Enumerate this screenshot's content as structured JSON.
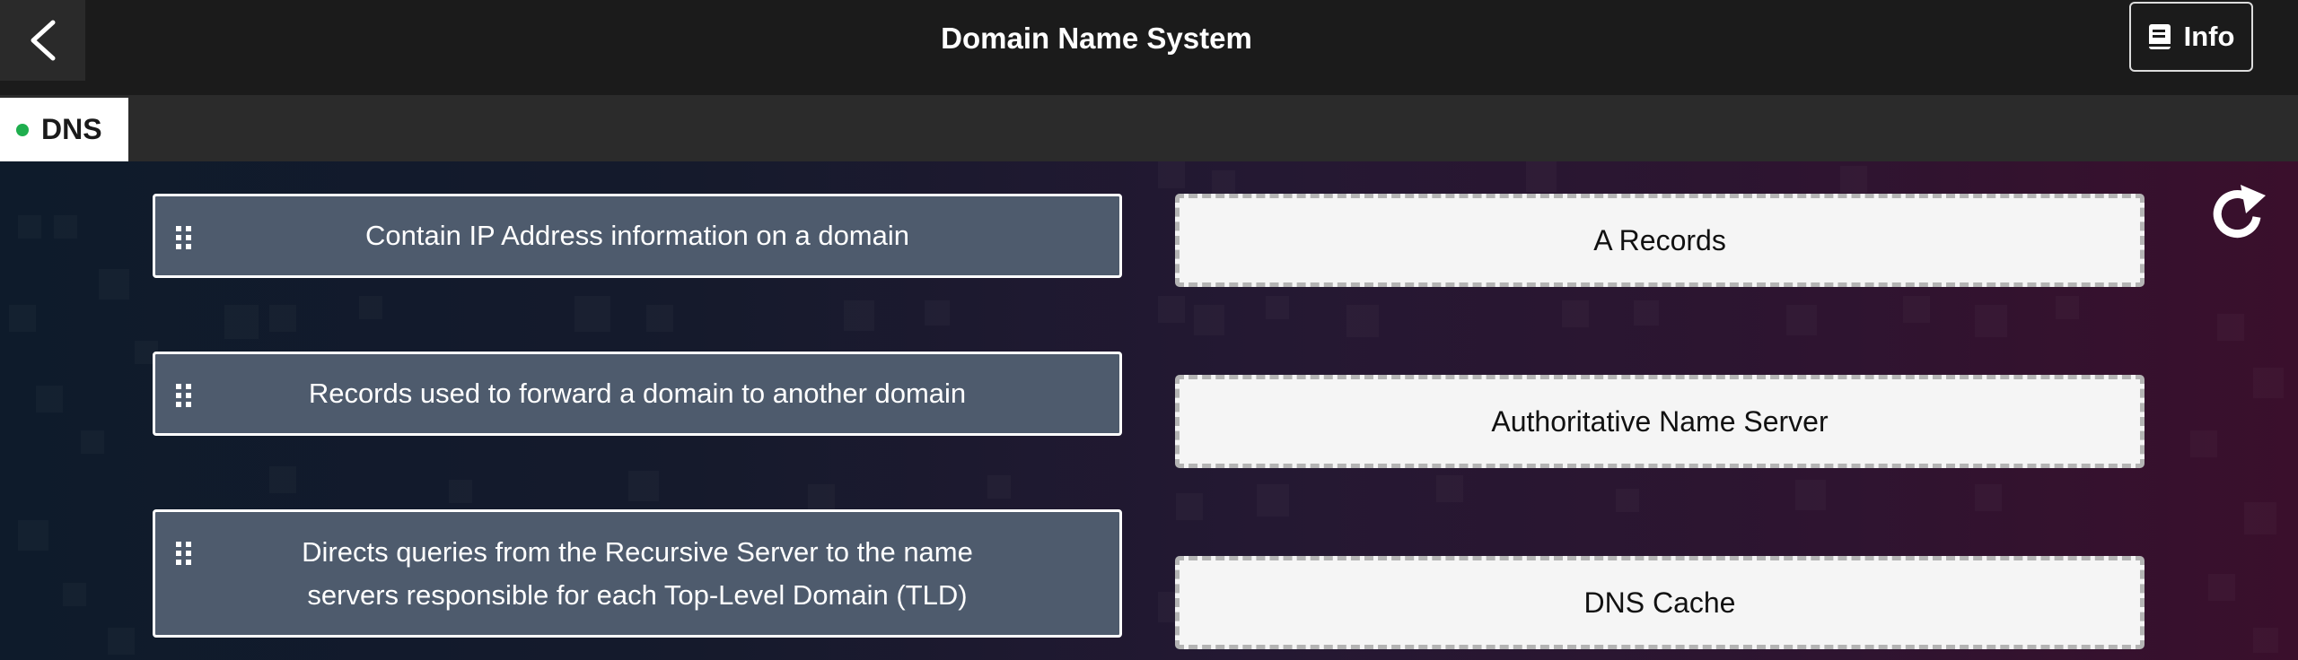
{
  "header": {
    "back_icon": "chevron-left-icon",
    "title": "Domain Name System",
    "info_label": "Info",
    "info_icon": "book-icon"
  },
  "tabs": [
    {
      "label": "DNS",
      "status_color": "#1fae4e",
      "active": true
    }
  ],
  "activity": {
    "draggable_items": [
      {
        "text": "Contain IP Address information on a domain"
      },
      {
        "text": "Records used to forward a domain to another domain"
      },
      {
        "text": "Directs queries from the Recursive Server to the name servers responsible for each Top-Level Domain (TLD)"
      }
    ],
    "drop_targets": [
      {
        "label": "A Records"
      },
      {
        "label": "Authoritative Name Server"
      },
      {
        "label": "DNS Cache"
      }
    ],
    "reset_icon": "reset-icon"
  },
  "colors": {
    "header_bg": "#1b1b1b",
    "tabbar_bg": "#2b2b2b",
    "card_bg": "#4e5b6d",
    "dropzone_bg": "#f5f5f5",
    "dropzone_border": "#b4b4b4"
  }
}
